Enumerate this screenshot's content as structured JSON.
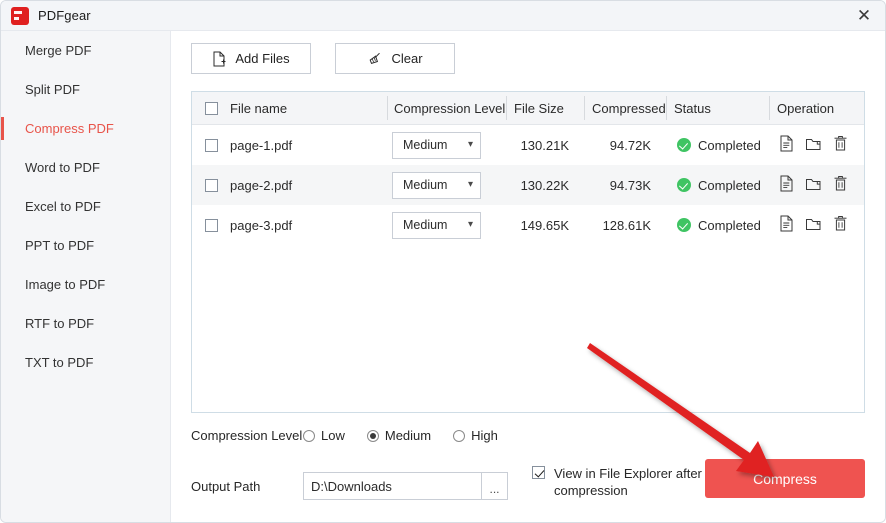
{
  "window": {
    "title": "PDFgear",
    "logo_icon": "pdfgear-logo",
    "close_icon": "close-icon",
    "close_label": "✕"
  },
  "sidebar": {
    "items": [
      {
        "label": "Merge PDF",
        "active": false
      },
      {
        "label": "Split PDF",
        "active": false
      },
      {
        "label": "Compress PDF",
        "active": true
      },
      {
        "label": "Word to PDF",
        "active": false
      },
      {
        "label": "Excel to PDF",
        "active": false
      },
      {
        "label": "PPT to PDF",
        "active": false
      },
      {
        "label": "Image to PDF",
        "active": false
      },
      {
        "label": "RTF to PDF",
        "active": false
      },
      {
        "label": "TXT to PDF",
        "active": false
      }
    ]
  },
  "toolbar": {
    "add_files_label": "Add Files",
    "add_files_icon": "file-plus-icon",
    "clear_label": "Clear",
    "clear_icon": "broom-icon"
  },
  "table": {
    "headers": {
      "file_name": "File name",
      "compression_level": "Compression Level",
      "file_size": "File Size",
      "compressed_size": "Compressed S",
      "status": "Status",
      "operation": "Operation"
    },
    "rows": [
      {
        "file_name": "page-1.pdf",
        "compression_level": "Medium",
        "file_size": "130.21K",
        "compressed_size": "94.72K",
        "status": "Completed",
        "checked": false
      },
      {
        "file_name": "page-2.pdf",
        "compression_level": "Medium",
        "file_size": "130.22K",
        "compressed_size": "94.73K",
        "status": "Completed",
        "checked": false
      },
      {
        "file_name": "page-3.pdf",
        "compression_level": "Medium",
        "file_size": "149.65K",
        "compressed_size": "128.61K",
        "status": "Completed",
        "checked": false
      }
    ],
    "operation_icons": [
      "preview-document-icon",
      "open-folder-icon",
      "delete-trash-icon"
    ],
    "status_icon": "check-circle-icon",
    "level_caret_icon": "chevron-down-icon"
  },
  "footer": {
    "compression_level_label": "Compression Level",
    "options": [
      {
        "label": "Low",
        "selected": false
      },
      {
        "label": "Medium",
        "selected": true
      },
      {
        "label": "High",
        "selected": false
      }
    ],
    "output_path_label": "Output Path",
    "output_path_value": "D:\\Downloads",
    "output_path_placeholder": "D:\\Downloads",
    "browse_label": "...",
    "explorer_checkbox_label": "View in File Explorer after compression",
    "explorer_checked": true,
    "compress_label": "Compress"
  },
  "annotation": {
    "arrow_icon": "red-arrow-annotation",
    "arrow_color": "#e02020"
  },
  "colors": {
    "accent": "#e8544a",
    "compress_button": "#ef5350",
    "status_green": "#3fc463",
    "sidebar_bg": "#f5f6f8",
    "titlebar_bg": "#f3f5f8"
  }
}
